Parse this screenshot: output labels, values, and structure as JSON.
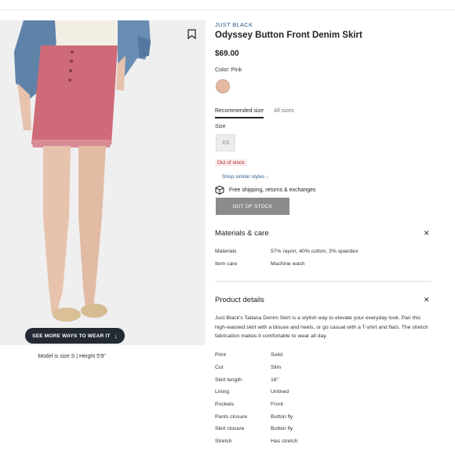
{
  "product": {
    "brand": "JUST BLACK",
    "title": "Odyssey Button Front Denim Skirt",
    "price": "$69.00",
    "color_label": "Color:",
    "color_value": "Pink",
    "swatch_color": "#e7b8a1"
  },
  "image": {
    "see_more_label": "SEE MORE WAYS TO WEAR IT",
    "model_note": "Model is size S | Height 5'9\""
  },
  "size": {
    "tabs": [
      "Recommended size",
      "All sizes"
    ],
    "label": "Size",
    "options": [
      "XS"
    ],
    "status": "Out of stock",
    "shop_similar": "Shop similar styles",
    "shipping": "Free shipping, returns & exchanges",
    "button_label": "OUT OF STOCK"
  },
  "materials": {
    "title": "Materials & care",
    "rows": [
      {
        "key": "Materials",
        "value": "57% rayon, 40% cotton, 3% spandex"
      },
      {
        "key": "Item care",
        "value": "Machine wash"
      }
    ]
  },
  "details": {
    "title": "Product details",
    "description": "Just Black's Tatiana Denim Skirt is a stylish way to elevate your everyday look. Pair this high-waisted skirt with a blouse and heels, or go casual with a T-shirt and flats. The stretch fabrication makes it comfortable to wear all day.",
    "rows": [
      {
        "key": "Print",
        "value": "Solid"
      },
      {
        "key": "Cut",
        "value": "Slim"
      },
      {
        "key": "Skirt length",
        "value": "16\""
      },
      {
        "key": "Lining",
        "value": "Unlined"
      },
      {
        "key": "Pockets",
        "value": "Front"
      },
      {
        "key": "Pants closure",
        "value": "Button fly"
      },
      {
        "key": "Skirt closure",
        "value": "Button fly"
      },
      {
        "key": "Stretch",
        "value": "Has stretch"
      }
    ]
  },
  "icons": {
    "bookmark": "bookmark-icon",
    "close": "close-icon",
    "box": "package-icon",
    "arrow": "arrow-down-icon"
  }
}
